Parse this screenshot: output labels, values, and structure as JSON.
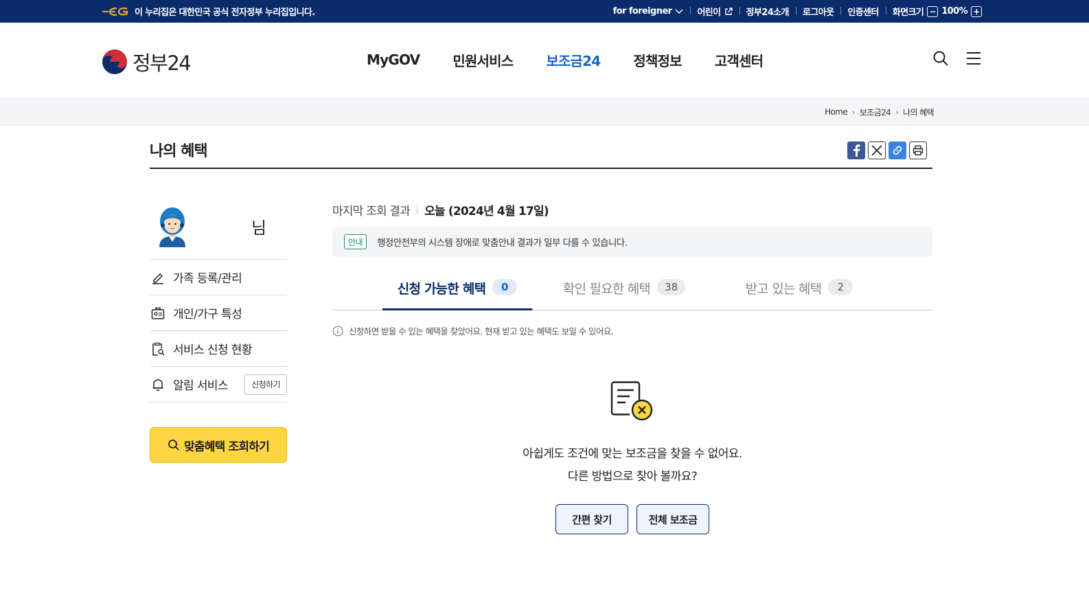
{
  "gov_bar": {
    "notice_text": "이 누리집은 대한민국 공식 전자정부 누리집입니다.",
    "links": [
      {
        "label": "for foreigner",
        "icon": "chevron-down-icon"
      },
      {
        "label": "어린이",
        "icon": "external-link-icon"
      },
      {
        "label": "정부24소개"
      },
      {
        "label": "로그아웃"
      },
      {
        "label": "인증센터"
      }
    ],
    "zoom": {
      "label": "화면크기",
      "minus": "−",
      "value": "100%",
      "plus": "+"
    }
  },
  "header": {
    "logo_text": "정부24",
    "menu": [
      "MyGOV",
      "민원서비스",
      "보조금24",
      "정책정보",
      "고객센터"
    ],
    "active_menu": "보조금24",
    "icons": [
      "search-icon",
      "hamburger-menu-icon"
    ]
  },
  "breadcrumb": [
    "Home",
    "보조금24",
    "나의 혜택"
  ],
  "page": {
    "title": "나의 혜택",
    "share_icons": [
      "facebook-icon",
      "x-icon",
      "link-icon",
      "print-icon"
    ]
  },
  "sidebar": {
    "user_suffix": "님",
    "items": [
      {
        "label": "가족 등록/관리",
        "icon": "pencil-icon"
      },
      {
        "label": "개인/가구 특성",
        "icon": "id-card-icon"
      },
      {
        "label": "서비스 신청 현황",
        "icon": "clipboard-search-icon"
      },
      {
        "label": "알림 서비스",
        "icon": "bell-icon",
        "button": "신청하기"
      }
    ],
    "search_button": "맞춤혜택 조회하기"
  },
  "main": {
    "last_lookup_label": "마지막 조회 결과",
    "last_lookup_value": "오늘 (2024년 4월 17일)",
    "notice_badge": "안내",
    "notice_text": "행정안전부의 시스템 장애로 맞춤안내 결과가 일부 다를 수 있습니다.",
    "tabs": [
      {
        "label": "신청 가능한 혜택",
        "count": "0",
        "active": true
      },
      {
        "label": "확인 필요한 혜택",
        "count": "38",
        "active": false
      },
      {
        "label": "받고 있는 혜택",
        "count": "2",
        "active": false
      }
    ],
    "info_text": "신청하면 받을 수 있는 혜택을 찾았어요. 현재 받고 있는 혜택도 보일 수 있어요.",
    "empty_line1": "아쉽게도 조건에 맞는 보조금을 찾을 수 없어요.",
    "empty_line2": "다른 방법으로 찾아 볼까요?",
    "buttons": [
      "간편 찾기",
      "전체 보조금"
    ]
  },
  "colors": {
    "gov_bar_bg": "#0b2b6b",
    "active_menu": "#1a63c4",
    "search_button_bg": "#ffd542",
    "notice_badge": "#1c8c6a"
  }
}
